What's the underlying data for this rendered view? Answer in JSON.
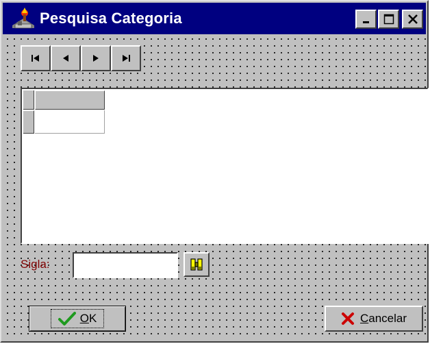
{
  "window": {
    "title": "Pesquisa Categoria",
    "icon": "building-icon",
    "controls": {
      "minimize_icon": "minimize-icon",
      "maximize_icon": "maximize-icon",
      "close_icon": "close-icon"
    }
  },
  "navigator": {
    "buttons": [
      {
        "name": "first",
        "icon": "first-record-icon"
      },
      {
        "name": "prior",
        "icon": "prior-record-icon"
      },
      {
        "name": "next",
        "icon": "next-record-icon"
      },
      {
        "name": "last",
        "icon": "last-record-icon"
      }
    ]
  },
  "grid": {
    "columns": [
      ""
    ],
    "rows": [
      [
        ""
      ]
    ]
  },
  "search": {
    "label": "Sigla:",
    "value": "",
    "find_icon": "binoculars-icon"
  },
  "buttons": {
    "ok": {
      "label_prefix": "",
      "label_underlined": "O",
      "label_rest": "K",
      "icon": "checkmark-icon"
    },
    "cancel": {
      "label_prefix": "",
      "label_underlined": "C",
      "label_rest": "ancelar",
      "icon": "x-icon"
    }
  },
  "colors": {
    "titlebar": "#000080",
    "face": "#c0c0c0",
    "label": "#800000",
    "ok_check": "#1f9a1f",
    "cancel_x": "#cc0000"
  }
}
